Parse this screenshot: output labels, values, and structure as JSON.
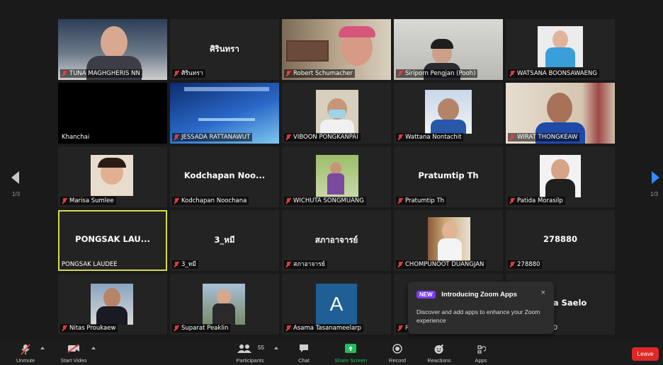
{
  "pages": {
    "left": "1/3",
    "right": "1/3"
  },
  "tiles": [
    {
      "label": "TUNA MAGHGHERIS NN",
      "big": ""
    },
    {
      "label": "ศิรินทรา",
      "big": "ศิรินทรา"
    },
    {
      "label": "Robert Schumacher",
      "big": ""
    },
    {
      "label": "Siriporn Pengjan (Pooh)",
      "big": ""
    },
    {
      "label": "WATSANA BOONSAWAENG",
      "big": ""
    },
    {
      "label": "Khanchai",
      "big": ""
    },
    {
      "label": "JESSADA RATTANAWUT",
      "big": ""
    },
    {
      "label": "VIBOON PONGKANPAI",
      "big": ""
    },
    {
      "label": "Wattana Nontachit",
      "big": ""
    },
    {
      "label": "WIRAT THONGKEAW",
      "big": ""
    },
    {
      "label": "Marisa Sumlee",
      "big": ""
    },
    {
      "label": "Kodchapan Noochana",
      "big": "Kodchapan Noo..."
    },
    {
      "label": "WICHUTA SONGMUANG",
      "big": ""
    },
    {
      "label": "Pratumtip Th",
      "big": "Pratumtip Th"
    },
    {
      "label": "Patida Morasilp",
      "big": ""
    },
    {
      "label": "PONGSAK LAUDEE",
      "big": "PONGSAK LAU..."
    },
    {
      "label": "3_หมี",
      "big": "3_หมี"
    },
    {
      "label": "สภาอาจารย์",
      "big": "สภาอาจารย์"
    },
    {
      "label": "CHOMPUNOOT DUANGJAN",
      "big": ""
    },
    {
      "label": "278880",
      "big": "278880"
    },
    {
      "label": "Nitas Proukaew",
      "big": ""
    },
    {
      "label": "Suparat Peaklin",
      "big": ""
    },
    {
      "label": "Asama Tasanameelarp",
      "big": ""
    },
    {
      "label": "R",
      "big": ""
    },
    {
      "label": "D",
      "big": "sa Saelo"
    }
  ],
  "avatar_letter": "A",
  "popup": {
    "badge": "NEW",
    "title": "Introducing Zoom Apps",
    "close": "×",
    "body": "Discover and add apps to enhance your Zoom experience"
  },
  "toolbar": {
    "unmute": "Unmute",
    "start_video": "Start Video",
    "participants_count": "55",
    "participants": "Participants",
    "chat": "Chat",
    "share_screen": "Share Screen",
    "record": "Record",
    "reactions": "Reactions",
    "apps": "Apps",
    "leave": "Leave"
  },
  "colors": {
    "active_outline": "#d4dc4c",
    "share_green": "#1fbf5a",
    "leave_red": "#e02828",
    "nav_blue": "#2d8cff"
  }
}
